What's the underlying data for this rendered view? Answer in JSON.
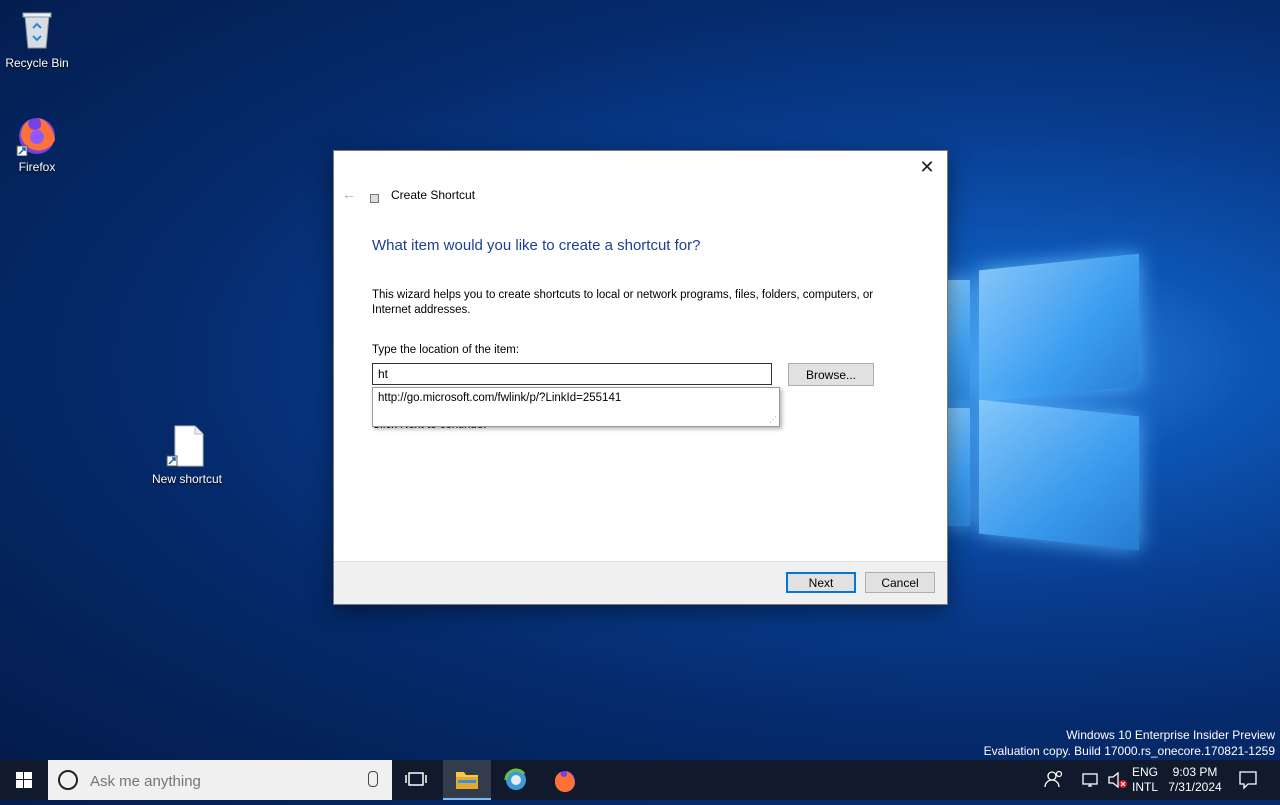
{
  "desktop": {
    "icons": [
      {
        "label": "Recycle Bin"
      },
      {
        "label": "Firefox"
      },
      {
        "label": "New shortcut"
      }
    ],
    "watermark_line1": "Windows 10 Enterprise Insider Preview",
    "watermark_line2": "Evaluation copy. Build 17000.rs_onecore.170821-1259"
  },
  "dialog": {
    "wizard_title": "Create Shortcut",
    "heading": "What item would you like to create a shortcut for?",
    "description": "This wizard helps you to create shortcuts to local or network programs, files, folders, computers, or Internet addresses.",
    "location_label": "Type the location of the item:",
    "location_value": "ht",
    "browse_label": "Browse...",
    "autocomplete_item": "http://go.microsoft.com/fwlink/p/?LinkId=255141",
    "next_hint": "Click Next to continue.",
    "next_label": "Next",
    "cancel_label": "Cancel"
  },
  "taskbar": {
    "search_placeholder": "Ask me anything",
    "lang_top": "ENG",
    "lang_bottom": "INTL",
    "time": "9:03 PM",
    "date": "7/31/2024"
  },
  "colors": {
    "heading": "#1c3f94",
    "accent": "#0078d7",
    "taskbar": "#101a2c"
  }
}
